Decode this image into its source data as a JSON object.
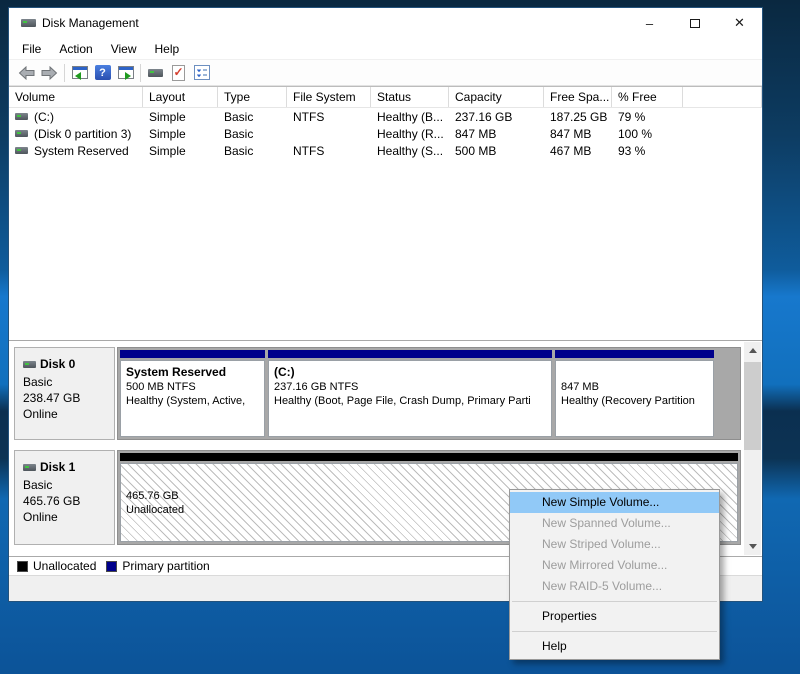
{
  "window": {
    "title": "Disk Management"
  },
  "titlebar": {
    "minimize_glyph": "–",
    "close_glyph": "✕"
  },
  "menubar": {
    "items": [
      "File",
      "Action",
      "View",
      "Help"
    ]
  },
  "toolbar": {
    "help_glyph": "?",
    "check_glyph": "✓"
  },
  "volume_table": {
    "columns": [
      "Volume",
      "Layout",
      "Type",
      "File System",
      "Status",
      "Capacity",
      "Free Spa...",
      "% Free"
    ],
    "rows": [
      {
        "cells": [
          "(C:)",
          "Simple",
          "Basic",
          "NTFS",
          "Healthy (B...",
          "237.16 GB",
          "187.25 GB",
          "79 %"
        ]
      },
      {
        "cells": [
          "(Disk 0 partition 3)",
          "Simple",
          "Basic",
          "",
          "Healthy (R...",
          "847 MB",
          "847 MB",
          "100 %"
        ]
      },
      {
        "cells": [
          "System Reserved",
          "Simple",
          "Basic",
          "NTFS",
          "Healthy (S...",
          "500 MB",
          "467 MB",
          "93 %"
        ]
      }
    ]
  },
  "disks": [
    {
      "name": "Disk 0",
      "kind": "Basic",
      "size": "238.47 GB",
      "status": "Online",
      "partitions": [
        {
          "title": "System Reserved",
          "line2": "500 MB NTFS",
          "line3": "Healthy (System, Active,",
          "band_color": "#00008b"
        },
        {
          "title": "(C:)",
          "line2": "237.16 GB NTFS",
          "line3": "Healthy (Boot, Page File, Crash Dump, Primary Parti",
          "band_color": "#00008b"
        },
        {
          "title": "",
          "line2": "847 MB",
          "line3": "Healthy (Recovery Partition",
          "band_color": "#00008b"
        }
      ]
    },
    {
      "name": "Disk 1",
      "kind": "Basic",
      "size": "465.76 GB",
      "status": "Online",
      "partitions": [
        {
          "title": "",
          "line2": "465.76 GB",
          "line3": "Unallocated",
          "band_color": "#000000"
        }
      ]
    }
  ],
  "legend": {
    "items": [
      {
        "label": "Unallocated",
        "color": "#000000"
      },
      {
        "label": "Primary partition",
        "color": "#00008b"
      }
    ]
  },
  "context_menu": {
    "highlight_color": "#91c9f7",
    "items": [
      {
        "label": "New Simple Volume...",
        "state": "highlighted"
      },
      {
        "label": "New Spanned Volume...",
        "state": "disabled"
      },
      {
        "label": "New Striped Volume...",
        "state": "disabled"
      },
      {
        "label": "New Mirrored Volume...",
        "state": "disabled"
      },
      {
        "label": "New RAID-5 Volume...",
        "state": "disabled"
      },
      {
        "label": "Properties",
        "state": "enabled"
      },
      {
        "label": "Help",
        "state": "enabled"
      }
    ]
  }
}
